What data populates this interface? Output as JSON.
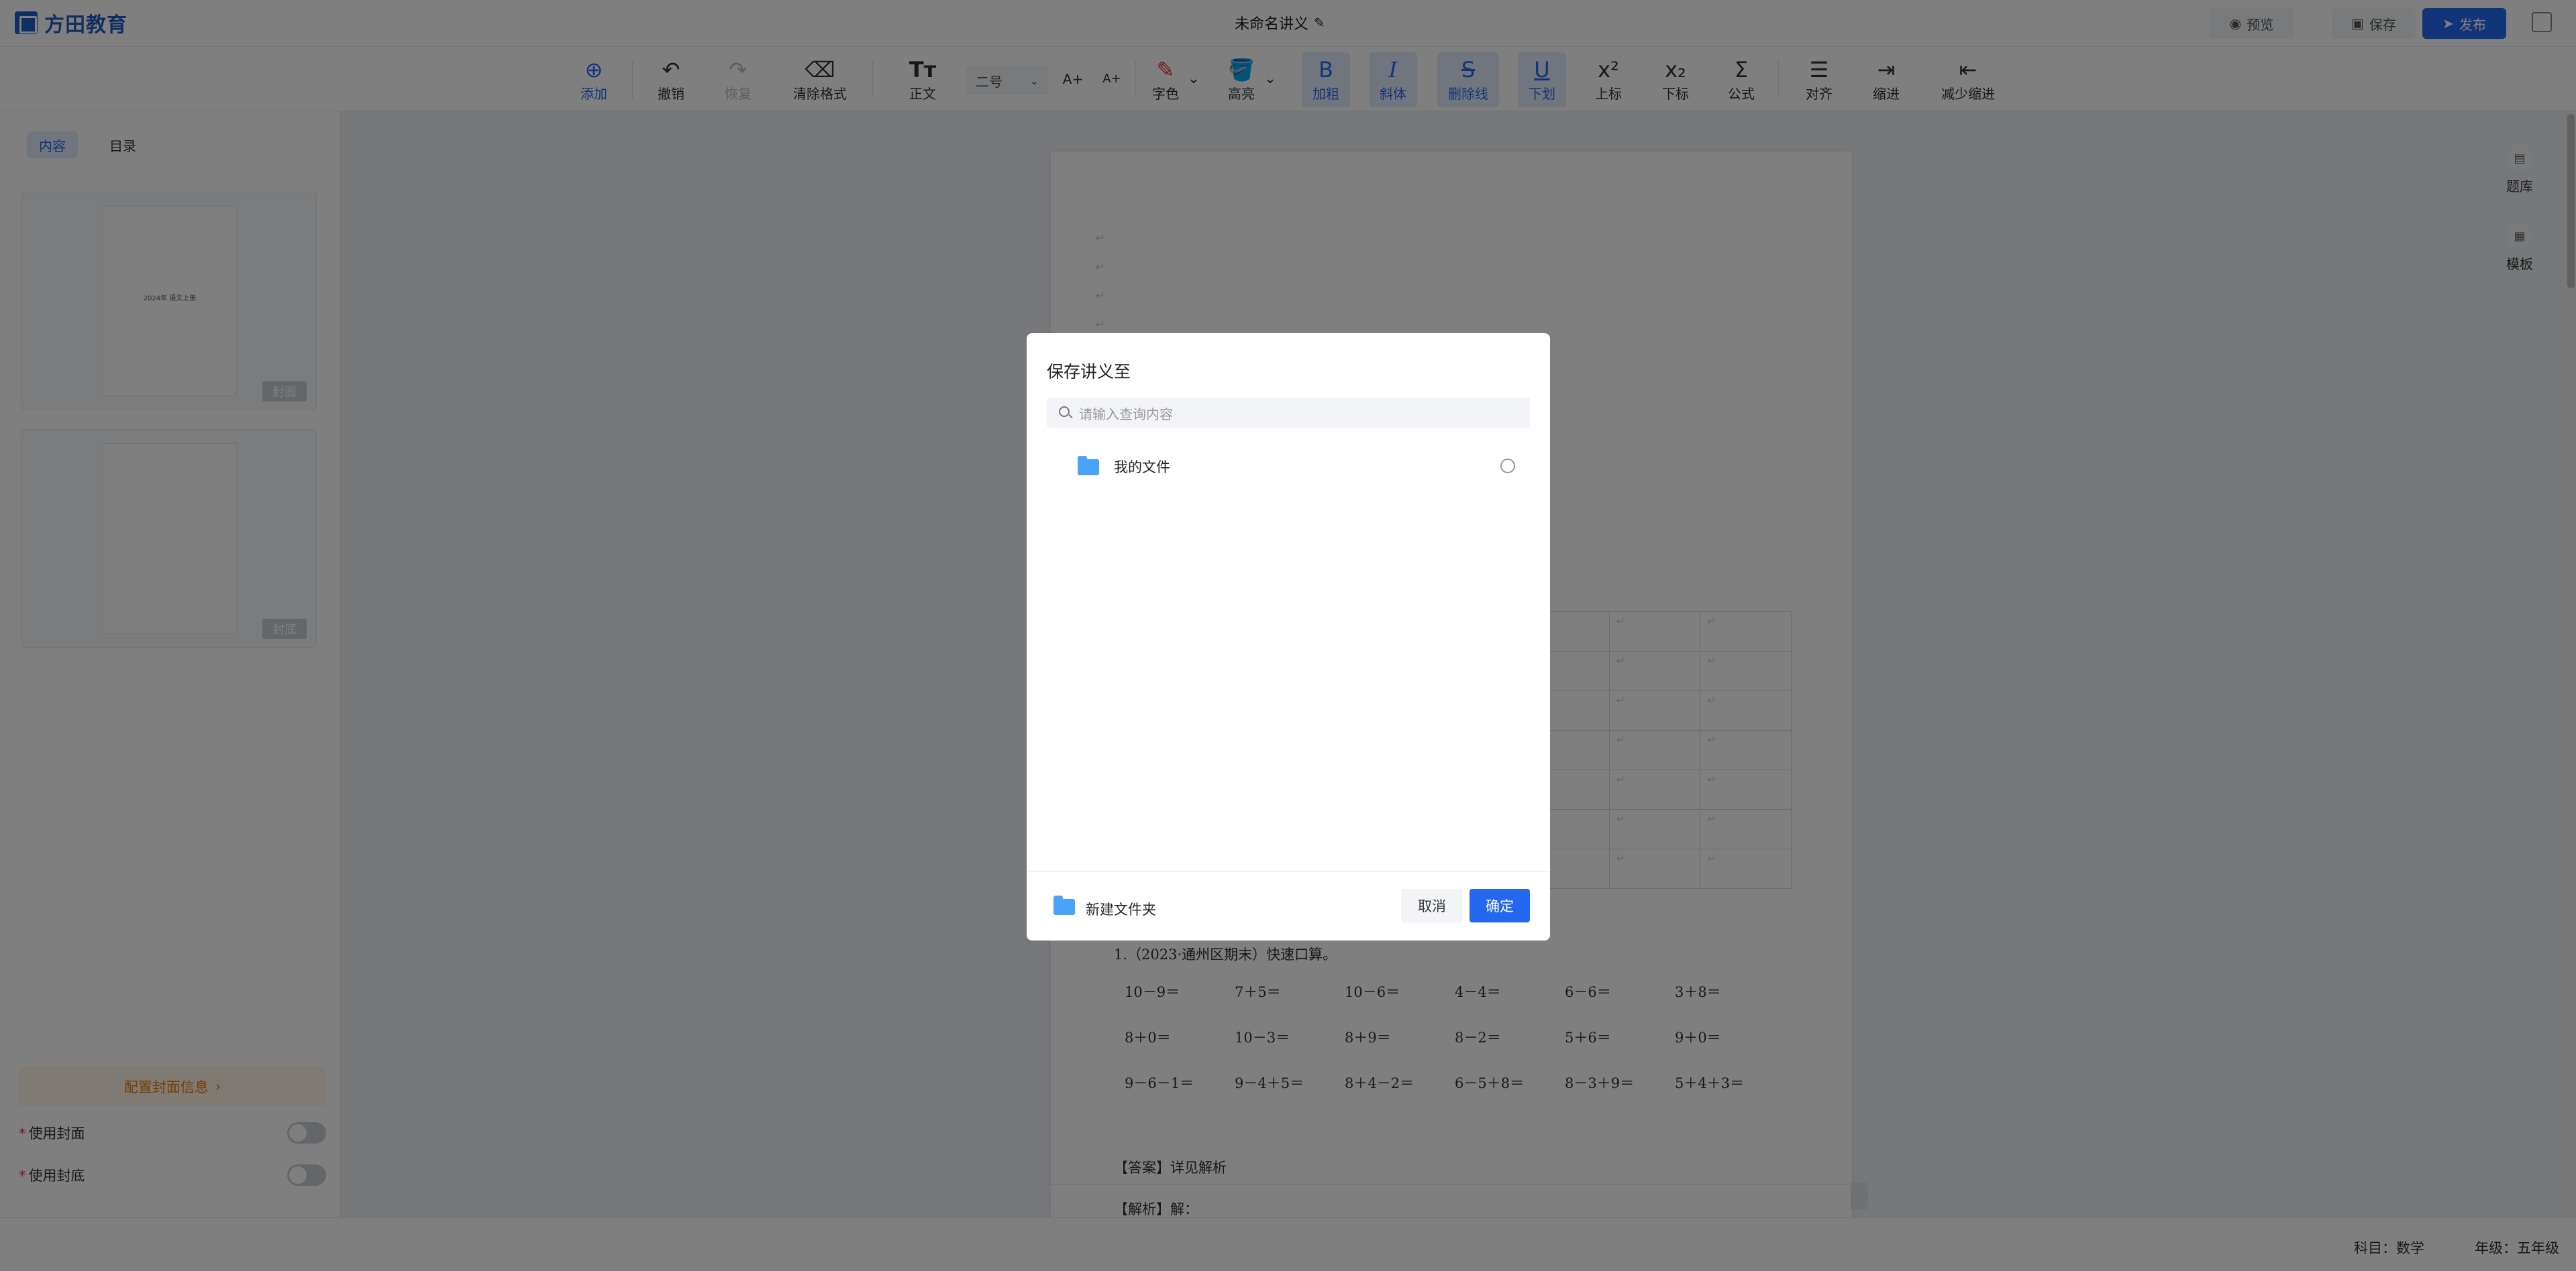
{
  "header": {
    "logo_text": "方田教育",
    "doc_title": "未命名讲义",
    "preview_label": "预览",
    "save_label": "保存",
    "publish_label": "发布"
  },
  "toolbar": {
    "add": "添加",
    "undo": "撤销",
    "redo": "恢复",
    "clear_format": "清除格式",
    "body_text": "正文",
    "font_size": "二号",
    "font_color": "字色",
    "highlight": "高亮",
    "bold": "加粗",
    "italic": "斜体",
    "strikethrough": "删除线",
    "underline": "下划",
    "superscript": "上标",
    "subscript": "下标",
    "formula": "公式",
    "align": "对齐",
    "indent": "缩进",
    "outdent": "减少缩进"
  },
  "sidebar": {
    "tab_content": "内容",
    "tab_toc": "目录",
    "thumb1_text": "2024年 语文上册",
    "thumb1_tag": "封面",
    "thumb2_tag": "封底",
    "config_cover": "配置封面信息",
    "use_cover": "使用封面",
    "use_back_cover": "使用封底"
  },
  "rail": {
    "question_bank": "题库",
    "template": "模板"
  },
  "document": {
    "question1": "1.（2023·通州区期末）快速口算。",
    "rows": [
      [
        "10－9＝",
        "7＋5＝",
        "10－6＝",
        "4－4＝",
        "6－6＝",
        "3＋8＝"
      ],
      [
        "8＋0＝",
        "10－3＝",
        "8＋9＝",
        "8－2＝",
        "5＋6＝",
        "9＋0＝"
      ],
      [
        "9－6－1＝",
        "9－4＋5＝",
        "8＋4－2＝",
        "6－5＋8＝",
        "8－3＋9＝",
        "5＋4＋3＝"
      ]
    ],
    "answer": "【答案】详见解析",
    "analysis": "【解析】解："
  },
  "status": {
    "subject": "科目：数学",
    "grade": "年级：五年级"
  },
  "modal": {
    "title": "保存讲义至",
    "search_placeholder": "请输入查询内容",
    "folder_name": "我的文件",
    "new_folder": "新建文件夹",
    "cancel": "取消",
    "confirm": "确定"
  }
}
